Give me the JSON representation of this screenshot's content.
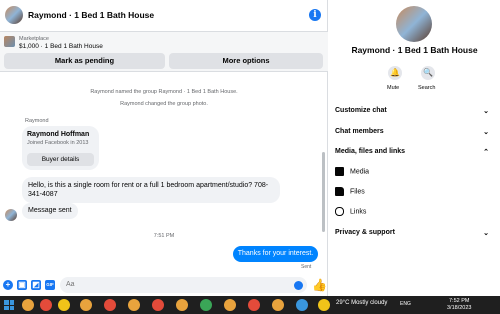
{
  "header": {
    "title": "Raymond · 1 Bed 1 Bath House",
    "info_icon": "i"
  },
  "marketplace": {
    "label": "Marketplace",
    "listing": "$1,000 · 1 Bed 1 Bath House",
    "pending_button": "Mark as pending",
    "more_button": "More options"
  },
  "conversation": {
    "system_1": "Raymond named the group Raymond · 1 Bed 1 Bath House.",
    "system_2": "Raymond changed the group photo.",
    "sender": "Raymond",
    "card": {
      "name": "Raymond Hoffman",
      "joined": "Joined Facebook in 2013",
      "button": "Buyer details"
    },
    "incoming_1": "Hello, is this a single room for rent or a full 1 bedroom apartment/studio? 708-341-4087",
    "incoming_2": "Message sent",
    "timestamp": "7:51 PM",
    "outgoing_1": "Thanks for your interest.",
    "status": "Sent"
  },
  "composer": {
    "placeholder": "Aa",
    "plus_icon": "+",
    "gif_label": "GIF"
  },
  "sidebar": {
    "title": "Raymond · 1 Bed 1 Bath House",
    "mute_label": "Mute",
    "search_label": "Search",
    "sections": {
      "customize": "Customize chat",
      "members": "Chat members",
      "media": "Media, files and links",
      "privacy": "Privacy & support"
    },
    "media_items": {
      "media": "Media",
      "files": "Files",
      "links": "Links"
    }
  },
  "taskbar": {
    "weather": "29°C  Mostly cloudy",
    "lang": "ENG",
    "time": "7:52 PM",
    "date": "3/18/2023"
  },
  "colors": {
    "accent": "#1877f2",
    "outgoing_bubble": "#0084ff",
    "incoming_bubble": "#f0f2f5"
  }
}
